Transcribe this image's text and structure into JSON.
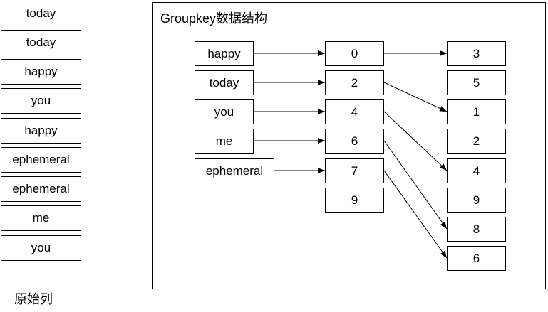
{
  "original_column": {
    "caption": "原始列",
    "items": [
      "today",
      "today",
      "happy",
      "you",
      "happy",
      "ephemeral",
      "ephemeral",
      "me",
      "you"
    ]
  },
  "groupkey": {
    "title": "Groupkey数据结构",
    "keys": [
      "happy",
      "today",
      "you",
      "me",
      "ephemeral"
    ],
    "offsets": [
      "0",
      "2",
      "4",
      "6",
      "7",
      "9"
    ],
    "indices": [
      "3",
      "5",
      "1",
      "2",
      "4",
      "9",
      "8",
      "6"
    ]
  },
  "links": {
    "key_to_offset": [
      [
        0,
        0
      ],
      [
        1,
        1
      ],
      [
        2,
        2
      ],
      [
        3,
        3
      ],
      [
        4,
        4
      ]
    ],
    "offset_to_index": [
      [
        0,
        0
      ],
      [
        1,
        2
      ],
      [
        2,
        4
      ],
      [
        3,
        6
      ],
      [
        4,
        7
      ]
    ]
  }
}
